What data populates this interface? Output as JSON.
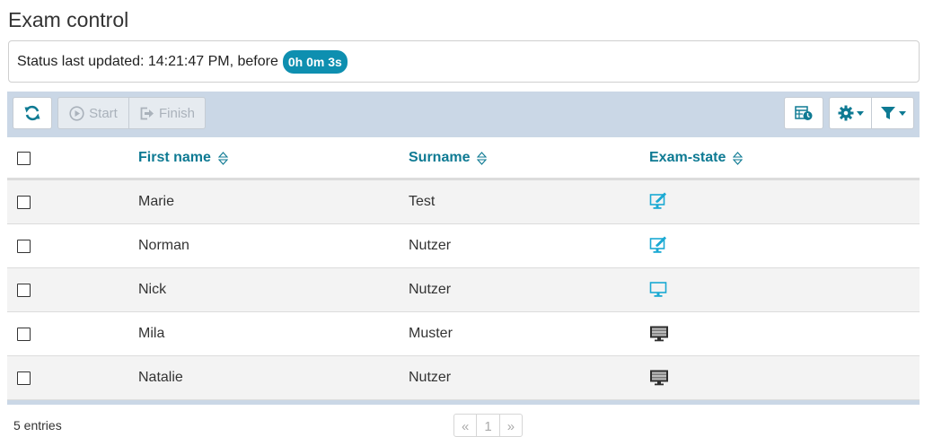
{
  "page": {
    "title": "Exam control"
  },
  "status": {
    "text": "Status last updated: 14:21:47 PM, before",
    "badge": "0h 0m 3s"
  },
  "toolbar": {
    "refresh_icon": "refresh-icon",
    "start_label": "Start",
    "finish_label": "Finish",
    "export_icon": "export-time-icon",
    "settings_icon": "gear-icon",
    "filter_icon": "filter-icon"
  },
  "table": {
    "columns": [
      "First name",
      "Surname",
      "Exam-state"
    ],
    "rows": [
      {
        "first": "Marie",
        "surname": "Test",
        "state": "monitor-edit-icon"
      },
      {
        "first": "Norman",
        "surname": "Nutzer",
        "state": "monitor-edit-icon"
      },
      {
        "first": "Nick",
        "surname": "Nutzer",
        "state": "monitor-blank-icon"
      },
      {
        "first": "Mila",
        "surname": "Muster",
        "state": "monitor-offline-icon"
      },
      {
        "first": "Natalie",
        "surname": "Nutzer",
        "state": "monitor-offline-icon"
      }
    ]
  },
  "footer": {
    "entries": "5 entries",
    "pager": {
      "prev": "«",
      "page": "1",
      "next": "»"
    }
  },
  "colors": {
    "accent": "#0e7a93",
    "badge": "#0e8fb0",
    "toolbar_bg": "#cad7e6",
    "icon_cyan": "#1aa9d3"
  }
}
